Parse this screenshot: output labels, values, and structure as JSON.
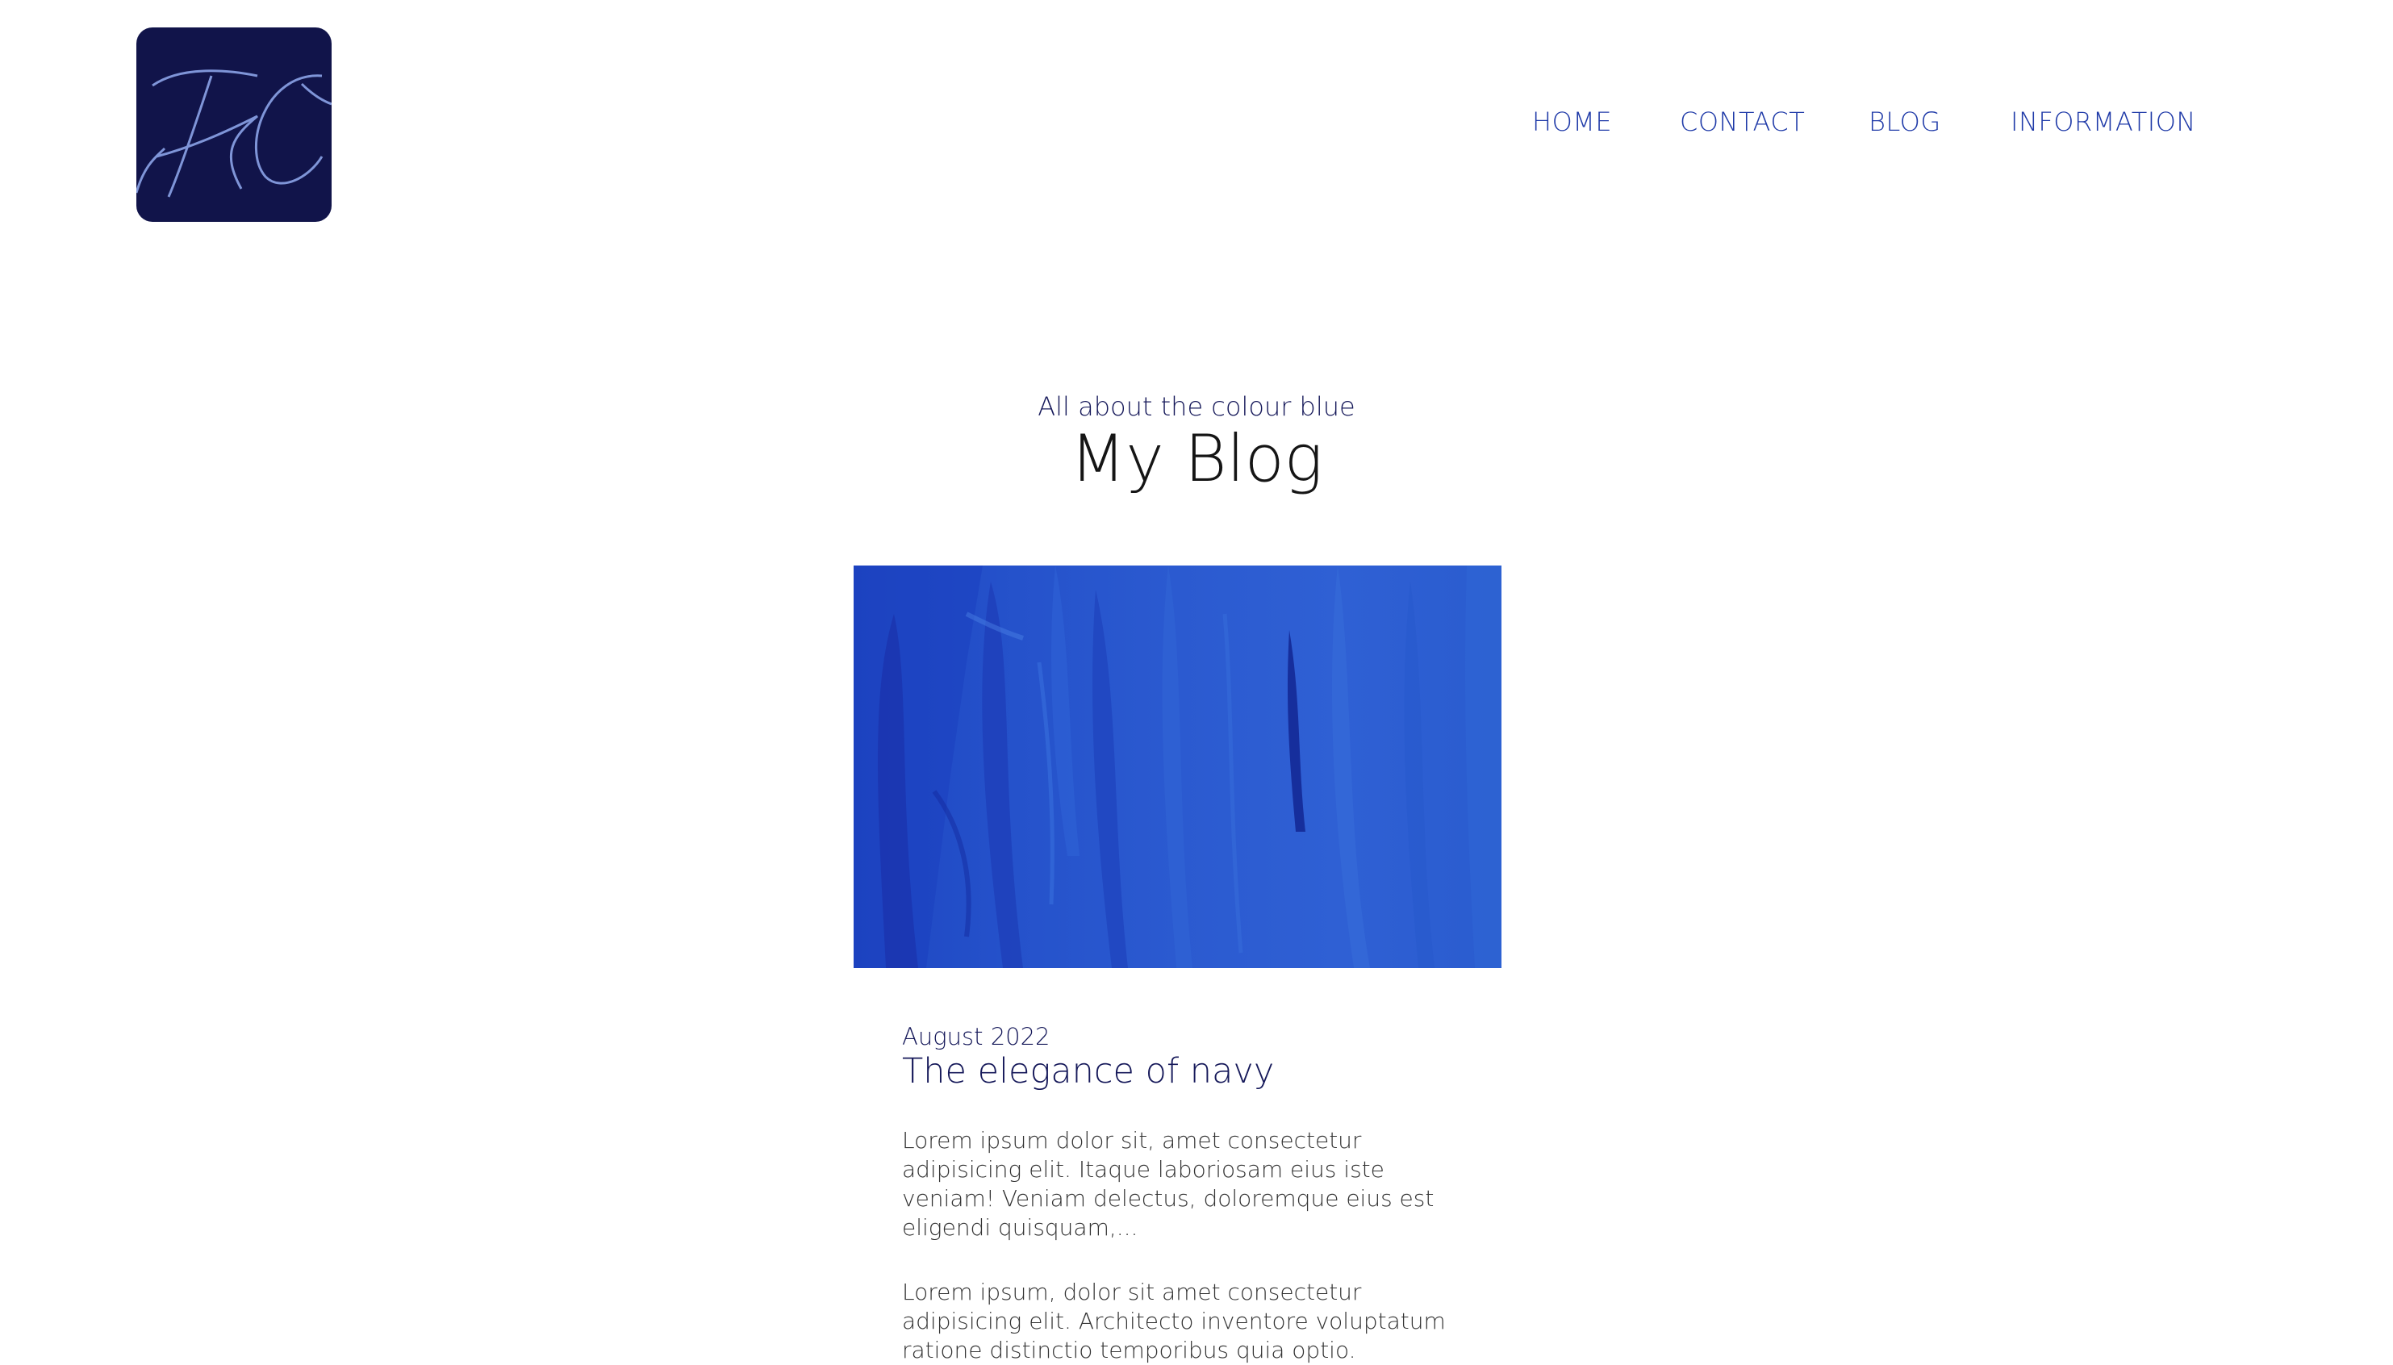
{
  "logo": {
    "text": "KC",
    "background_color": "#11144a",
    "stroke_color": "#7f95d8"
  },
  "nav": {
    "items": [
      {
        "label": "HOME"
      },
      {
        "label": "CONTACT"
      },
      {
        "label": "BLOG"
      },
      {
        "label": "INFORMATION"
      }
    ],
    "color": "#1f3aa8"
  },
  "header": {
    "subtitle": "All about the colour blue",
    "title": "My Blog"
  },
  "post": {
    "image_description_icon": "blue-paint-texture",
    "date": "August 2022",
    "title": "The elegance of navy",
    "excerpts": [
      "Lorem ipsum dolor sit, amet consectetur adipisicing elit. Itaque laboriosam eius iste veniam! Veniam delectus, doloremque eius est eligendi quisquam,...",
      "Lorem ipsum, dolor sit amet consectetur adipisicing elit. Architecto inventore voluptatum ratione distinctio temporibus quia optio. Dignissimos..."
    ]
  },
  "colors": {
    "accent": "#1f3aa8",
    "dark_navy": "#16195a",
    "hero_blue": "#2a57c8"
  }
}
